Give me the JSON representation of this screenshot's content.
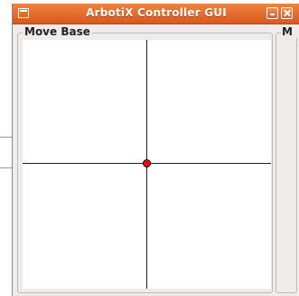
{
  "window": {
    "title": "ArbotiX Controller GUI",
    "accent_color": "#e0672c"
  },
  "title_bar": {
    "app_icon": "window-icon",
    "minimize_icon": "minimize-icon",
    "close_icon": "close-icon"
  },
  "move_base": {
    "label": "Move Base",
    "joystick": {
      "position": {
        "x": 0,
        "y": 0
      },
      "dot_color": "#ff0000"
    }
  },
  "second_panel": {
    "label": "M"
  }
}
